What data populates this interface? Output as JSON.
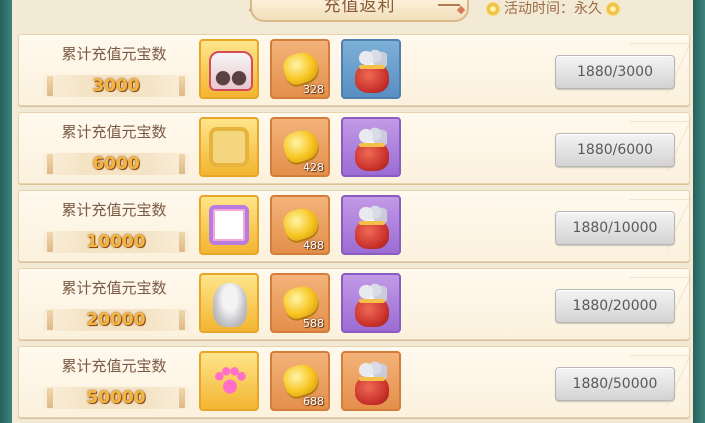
{
  "header": {
    "title": "充值返利",
    "event_time": "活动时间：永久"
  },
  "tiers": [
    {
      "label": "累计充值元宝数",
      "amount": "3000",
      "rewards": [
        {
          "icon": "car-icon"
        },
        {
          "icon": "gold-ingot-icon",
          "count": "328"
        },
        {
          "icon": "lucky-bag-icon",
          "bg": "blue"
        }
      ],
      "progress": "1880/3000"
    },
    {
      "label": "累计充值元宝数",
      "amount": "6000",
      "rewards": [
        {
          "icon": "gold-frame-icon"
        },
        {
          "icon": "gold-ingot-icon",
          "count": "428"
        },
        {
          "icon": "lucky-bag-icon",
          "bg": "purple"
        }
      ],
      "progress": "1880/6000"
    },
    {
      "label": "累计充值元宝数",
      "amount": "10000",
      "rewards": [
        {
          "icon": "rainbow-frame-icon"
        },
        {
          "icon": "gold-ingot-icon",
          "count": "488"
        },
        {
          "icon": "lucky-bag-icon",
          "bg": "purple"
        }
      ],
      "progress": "1880/10000"
    },
    {
      "label": "累计充值元宝数",
      "amount": "20000",
      "rewards": [
        {
          "icon": "hairstyle-icon"
        },
        {
          "icon": "gold-ingot-icon",
          "count": "588"
        },
        {
          "icon": "lucky-bag-icon",
          "bg": "purple"
        }
      ],
      "progress": "1880/20000"
    },
    {
      "label": "累计充值元宝数",
      "amount": "50000",
      "rewards": [
        {
          "icon": "paw-print-icon"
        },
        {
          "icon": "gold-ingot-icon",
          "count": "688"
        },
        {
          "icon": "lucky-bag-icon",
          "bg": "orange"
        }
      ],
      "progress": "1880/50000"
    }
  ]
}
